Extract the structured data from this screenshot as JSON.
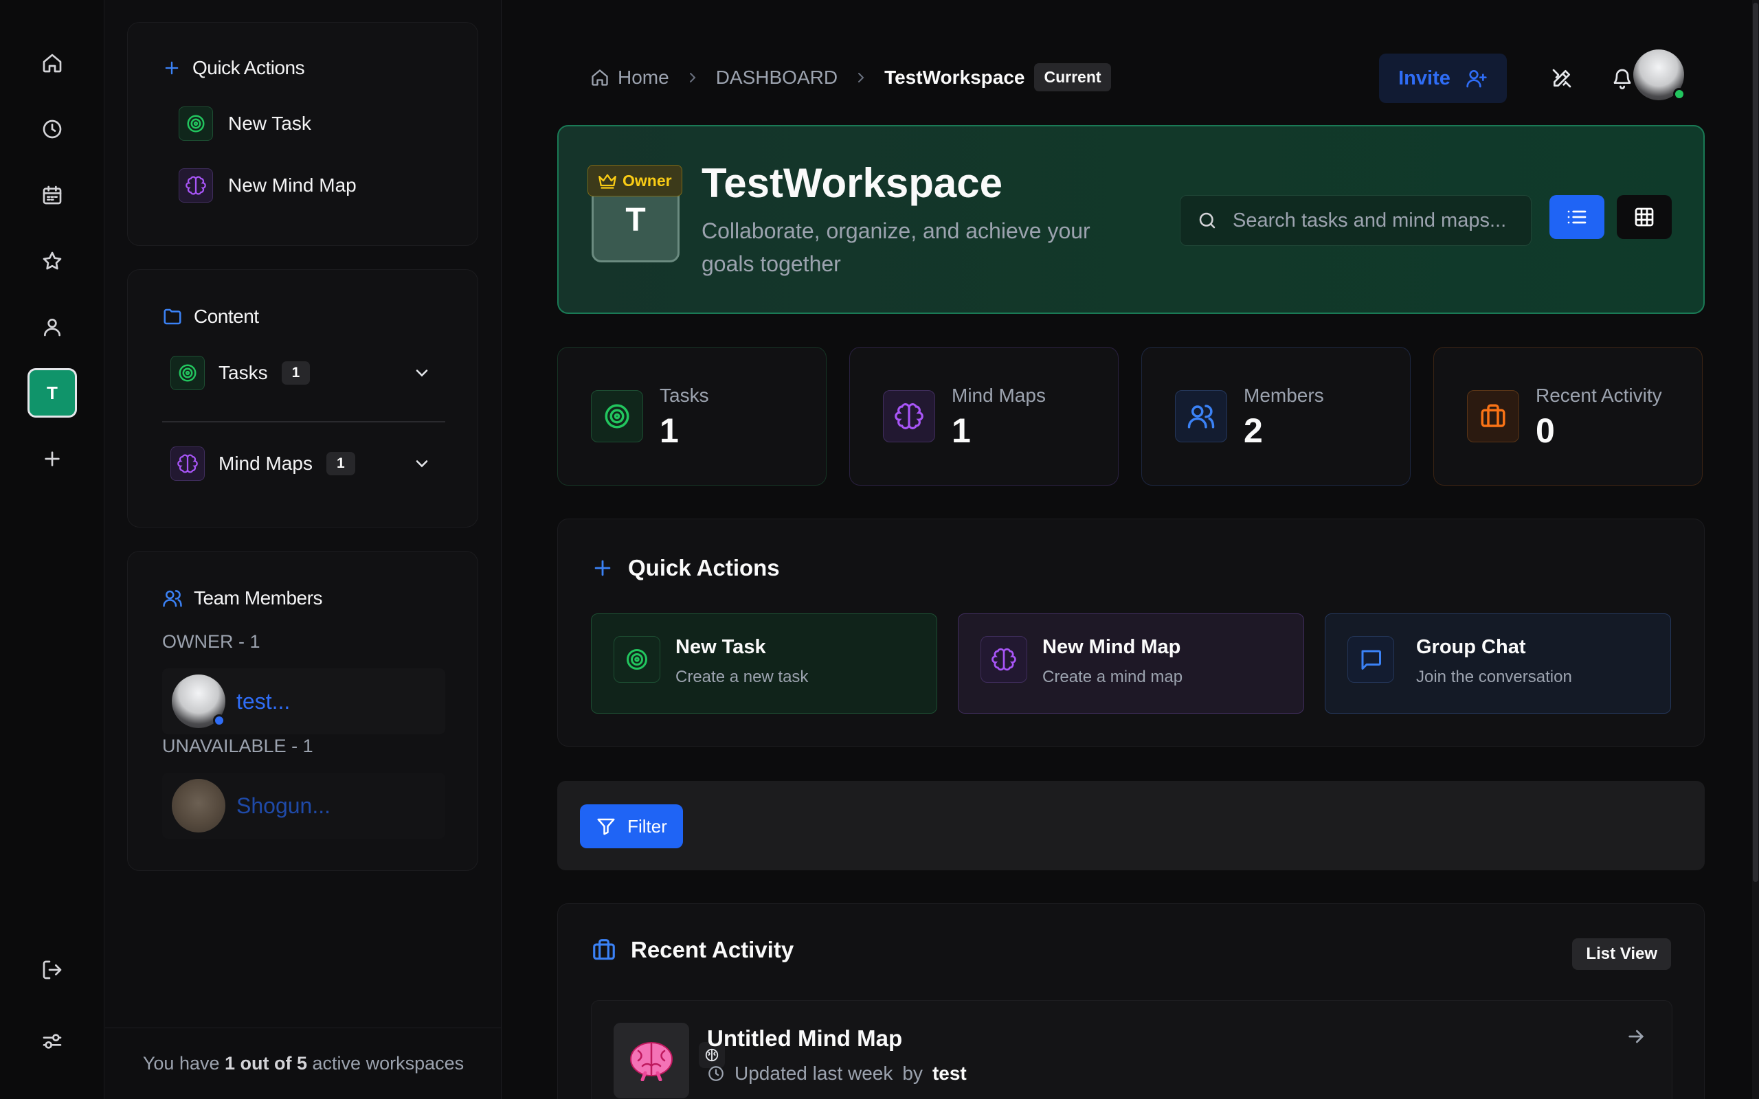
{
  "rail": {
    "workspace_initial": "T"
  },
  "sidebar": {
    "quick_actions": {
      "title": "Quick Actions",
      "items": [
        {
          "label": "New Task",
          "icon": "target-icon"
        },
        {
          "label": "New Mind Map",
          "icon": "brain-icon"
        }
      ]
    },
    "content": {
      "title": "Content",
      "items": [
        {
          "label": "Tasks",
          "count": "1"
        },
        {
          "label": "Mind Maps",
          "count": "1"
        }
      ]
    },
    "team": {
      "title": "Team Members",
      "groups": [
        {
          "heading": "OWNER - 1",
          "member": "test..."
        },
        {
          "heading": "UNAVAILABLE - 1",
          "member": "Shogun..."
        }
      ]
    },
    "footer": {
      "prefix": "You have",
      "count": "1 out of 5",
      "suffix": "active workspaces"
    }
  },
  "header": {
    "breadcrumb": {
      "home": "Home",
      "section": "DASHBOARD",
      "current": "TestWorkspace",
      "tag": "Current"
    },
    "invite_label": "Invite"
  },
  "hero": {
    "initial": "T",
    "owner_label": "Owner",
    "title": "TestWorkspace",
    "subtitle": "Collaborate, organize, and achieve your goals together",
    "search_placeholder": "Search tasks and mind maps..."
  },
  "stats": [
    {
      "label": "Tasks",
      "value": "1"
    },
    {
      "label": "Mind Maps",
      "value": "1"
    },
    {
      "label": "Members",
      "value": "2"
    },
    {
      "label": "Recent Activity",
      "value": "0"
    }
  ],
  "quick_actions": {
    "title": "Quick Actions",
    "cards": [
      {
        "title": "New Task",
        "subtitle": "Create a new task"
      },
      {
        "title": "New Mind Map",
        "subtitle": "Create a mind map"
      },
      {
        "title": "Group Chat",
        "subtitle": "Join the conversation"
      }
    ]
  },
  "filter": {
    "label": "Filter"
  },
  "recent_activity": {
    "title": "Recent Activity",
    "view_tag": "List View",
    "items": [
      {
        "title": "Untitled Mind Map",
        "updated": "Updated last week",
        "by_label": "by",
        "author": "test"
      }
    ]
  },
  "colors": {
    "accent_blue": "#1f64f5",
    "green": "#22c55e",
    "purple": "#a855f7",
    "orange": "#f97316",
    "hero_border": "#1a7a55"
  }
}
